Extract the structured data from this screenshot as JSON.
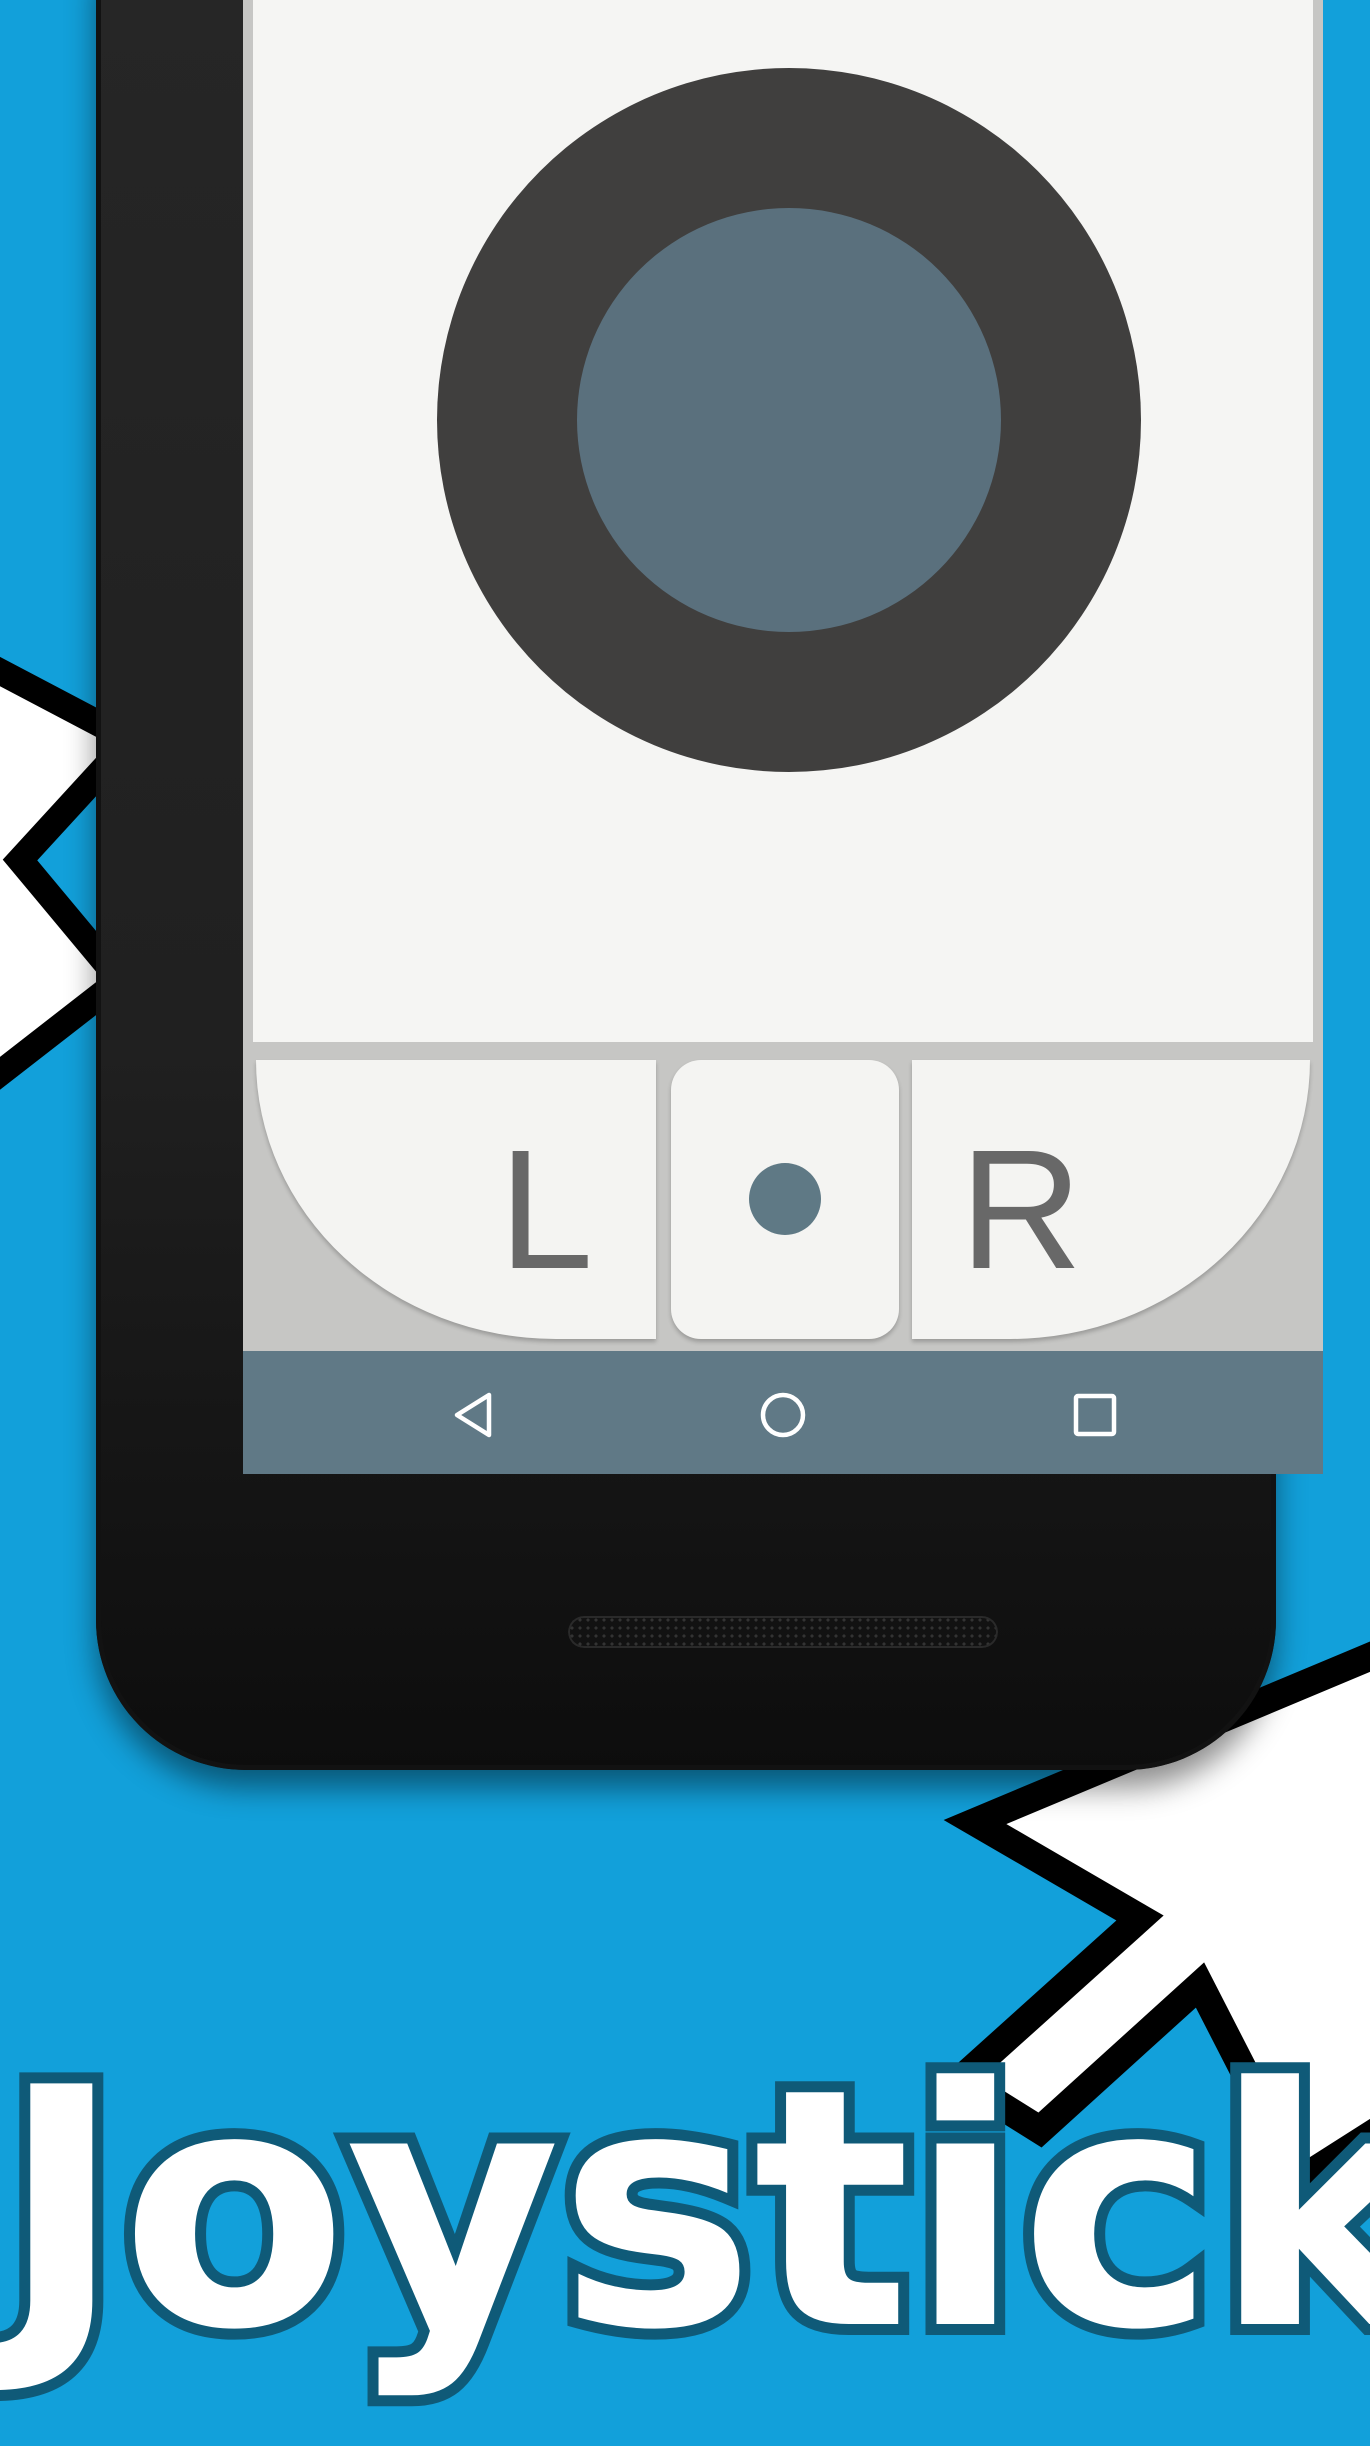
{
  "app": {
    "title": "Joystick"
  },
  "controls": {
    "left_button_label": "L",
    "right_button_label": "R"
  },
  "navigation": {
    "icons": [
      "back-icon",
      "home-icon",
      "recents-icon"
    ]
  },
  "colors": {
    "background": "#12a0da",
    "stick_base": "#403f3e",
    "stick_knob": "#5a707d",
    "nav_bar": "#607986",
    "title_outline": "#0f5a78"
  }
}
